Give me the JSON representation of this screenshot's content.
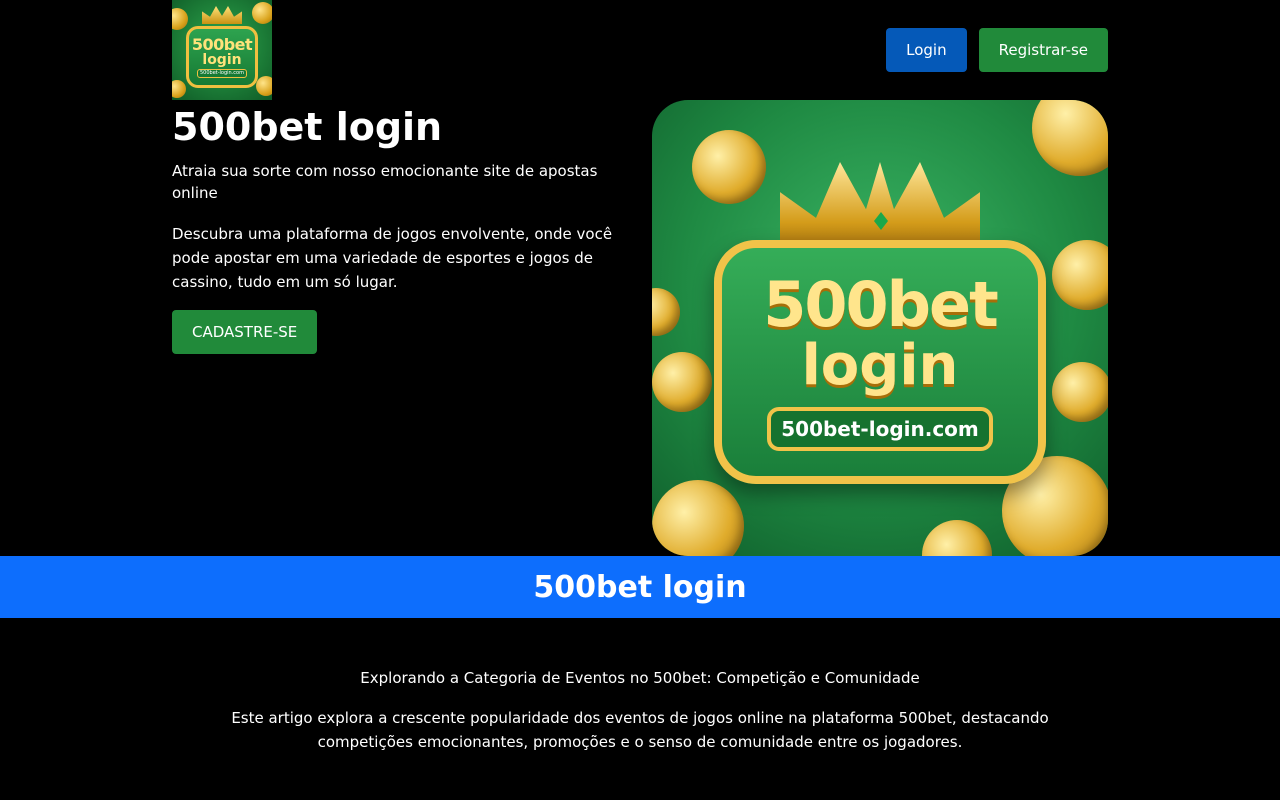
{
  "header": {
    "logo": {
      "line1": "500bet",
      "line2": "login",
      "domain": "500bet-login.com"
    },
    "login_label": "Login",
    "register_label": "Registrar-se"
  },
  "hero": {
    "title": "500bet login",
    "subtitle": "Atraia sua sorte com nosso emocionante site de apostas online",
    "description": "Descubra uma plataforma de jogos envolvente, onde você pode apostar em uma variedade de esportes e jogos de cassino, tudo em um só lugar.",
    "cta_label": "CADASTRE-SE",
    "image": {
      "line1": "500bet",
      "line2": "login",
      "domain": "500bet-login.com"
    }
  },
  "banner": {
    "title": "500bet login"
  },
  "article": {
    "title": "Explorando a Categoria de Eventos no 500bet: Competição e Comunidade",
    "description": "Este artigo explora a crescente popularidade dos eventos de jogos online na plataforma 500bet, destacando competições emocionantes, promoções e o senso de comunidade entre os jogadores."
  },
  "colors": {
    "background": "#000000",
    "login_button": "#0559b8",
    "register_button": "#218a3a",
    "banner": "#0d6efd"
  }
}
